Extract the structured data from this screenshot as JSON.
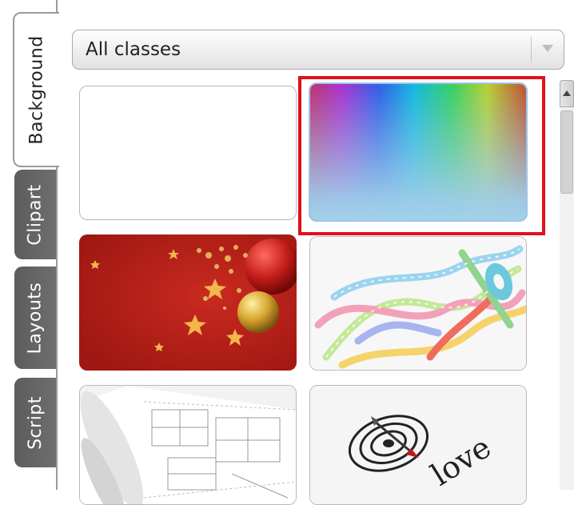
{
  "tabs": [
    {
      "label": "Background",
      "active": true
    },
    {
      "label": "Clipart",
      "active": false
    },
    {
      "label": "Layouts",
      "active": false
    },
    {
      "label": "Script",
      "active": false
    }
  ],
  "dropdown": {
    "selected": "All classes"
  },
  "thumbnails": [
    {
      "name": "blank-white"
    },
    {
      "name": "rainbow-gradient",
      "selected": true
    },
    {
      "name": "red-christmas-ornaments"
    },
    {
      "name": "colorful-ribbons"
    },
    {
      "name": "architectural-blueprints"
    },
    {
      "name": "love-target"
    }
  ],
  "thumbnail_texts": {
    "love": "love"
  },
  "colors": {
    "selection": "#e0101b",
    "tab": "#606060",
    "christmas_red": "#c0201c"
  }
}
